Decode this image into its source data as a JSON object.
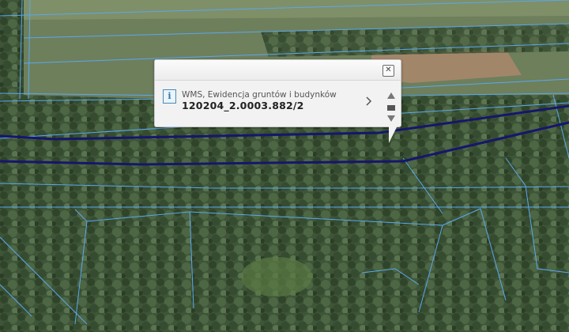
{
  "popup": {
    "layer_name": "WMS, Ewidencja gruntów i budynków",
    "feature_id": "120204_2.0003.882/2",
    "close_icon": "close-icon",
    "info_icon": "info-icon",
    "info_glyph": "i",
    "next_icon": "chevron-right-icon",
    "pager_icons": [
      "arrow-up-icon",
      "pause-icon",
      "arrow-down-icon"
    ]
  },
  "map": {
    "basemap": "aerial orthophoto",
    "parcel_line_color": "#5aa8f0",
    "road_line_color": "#16166e"
  }
}
